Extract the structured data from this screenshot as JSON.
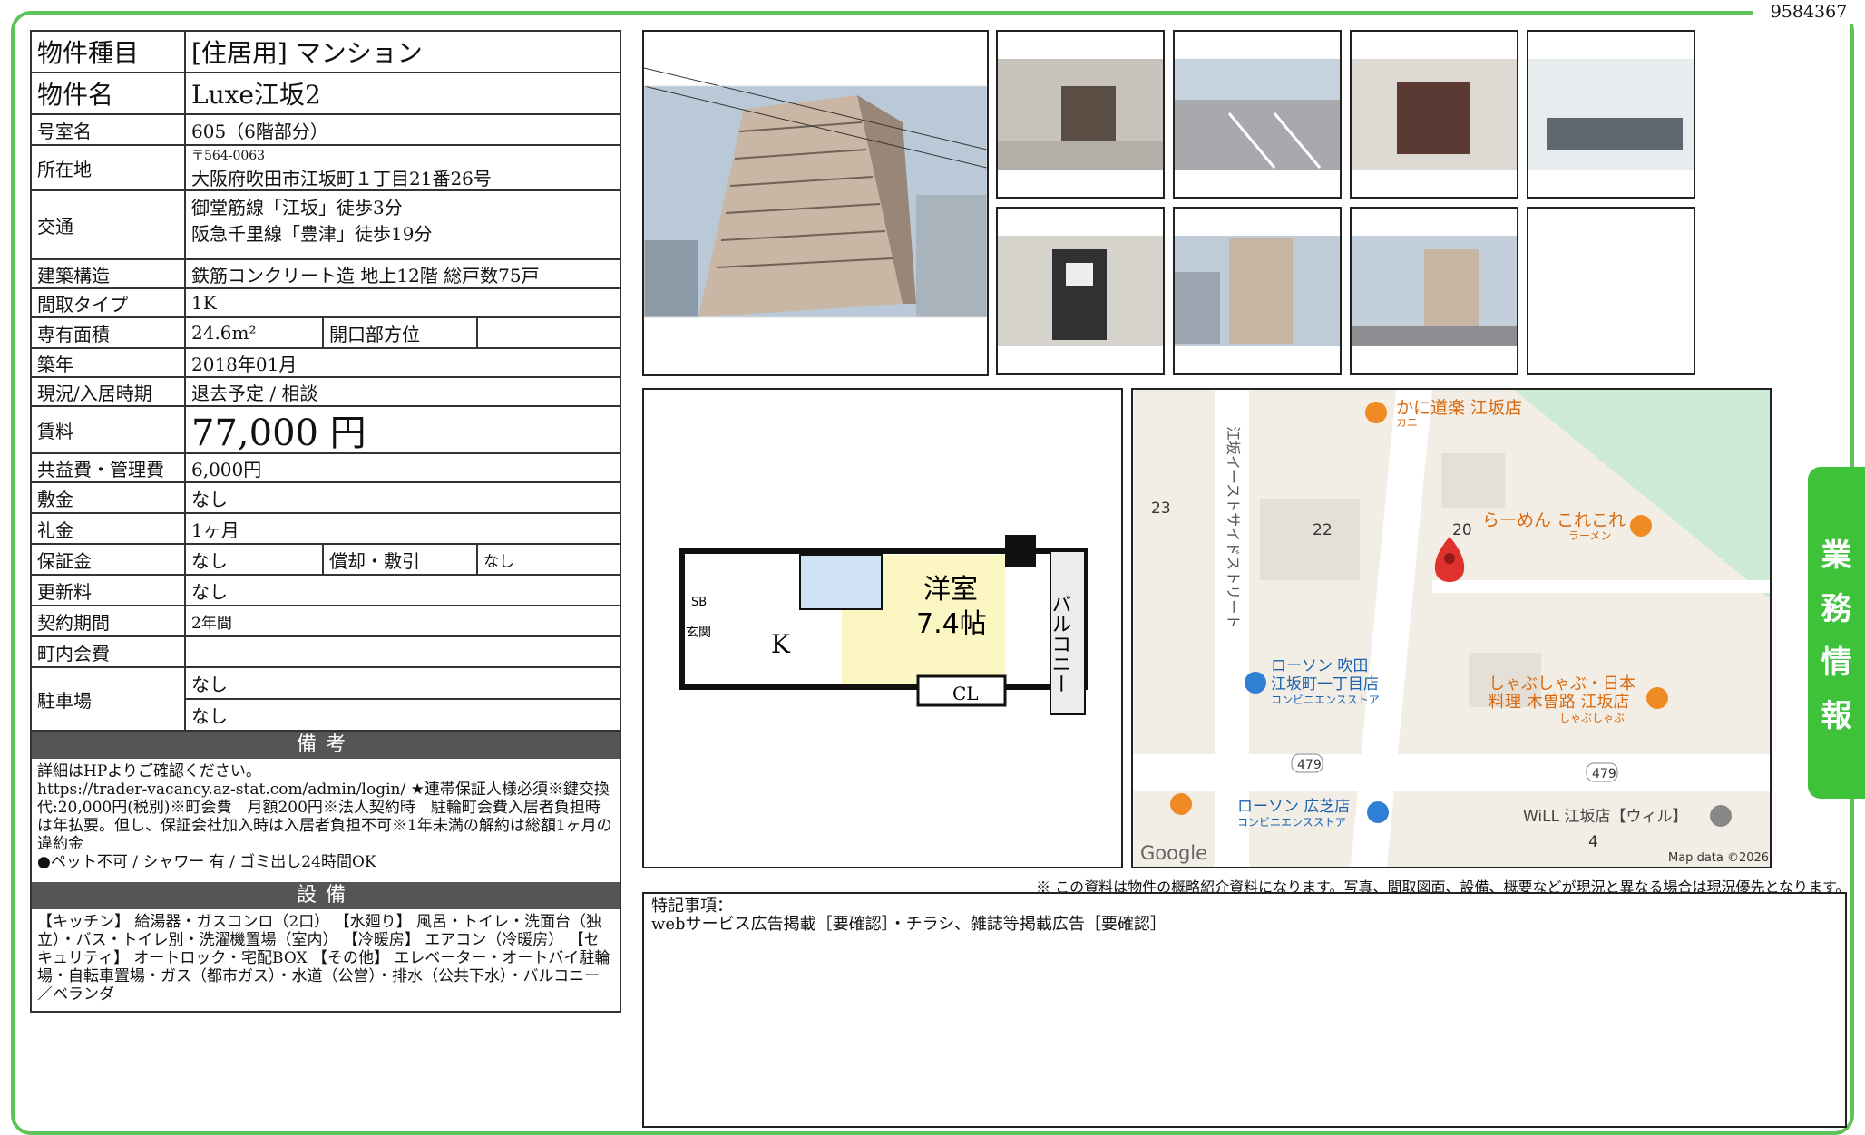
{
  "doc_id": "9584367",
  "side_tab": [
    "業",
    "務",
    "情",
    "報"
  ],
  "property": {
    "type_label": "物件種目",
    "type_value": "[住居用] マンション",
    "name_label": "物件名",
    "name_value": "Luxe江坂2",
    "room_label": "号室名",
    "room_value": "605（6階部分）",
    "address_label": "所在地",
    "postal": "〒564-0063",
    "address": "大阪府吹田市江坂町１丁目21番26号",
    "transport_label": "交通",
    "transport_1": "御堂筋線「江坂」徒歩3分",
    "transport_2": "阪急千里線「豊津」徒歩19分",
    "structure_label": "建築構造",
    "structure_value": "鉄筋コンクリート造 地上12階 総戸数75戸",
    "layout_label": "間取タイプ",
    "layout_value": "1K",
    "area_label": "専有面積",
    "area_value": "24.6m²",
    "direction_label": "開口部方位",
    "direction_value": "",
    "built_label": "築年",
    "built_value": "2018年01月",
    "status_label": "現況/入居時期",
    "status_value": "退去予定 / 相談",
    "rent_label": "賃料",
    "rent_value": "77,000 円",
    "fee_label": "共益費・管理費",
    "fee_value": "6,000円",
    "deposit_label": "敷金",
    "deposit_value": "なし",
    "key_money_label": "礼金",
    "key_money_value": "1ヶ月",
    "guarantee_label": "保証金",
    "guarantee_value": "なし",
    "amort_label": "償却・敷引",
    "amort_value": "なし",
    "renewal_label": "更新料",
    "renewal_value": "なし",
    "contract_label": "契約期間",
    "contract_value": "2年間",
    "town_fee_label": "町内会費",
    "town_fee_value": "",
    "parking_label": "駐車場",
    "parking_value_1": "なし",
    "parking_value_2": "なし"
  },
  "remarks_head": "備考",
  "remarks_text": "詳細はHPよりご確認ください。\nhttps://trader-vacancy.az-stat.com/admin/login/ ★連帯保証人様必須※鍵交換代:20,000円(税別)※町会費　月額200円※法人契約時　駐輪町会費入居者負担時は年払要。但し、保証会社加入時は入居者負担不可※1年未満の解約は総額1ヶ月の違約金\n●ペット不可 / シャワー 有 / ゴミ出し24時間OK",
  "equipment_head": "設備",
  "equipment_text": "【キッチン】 給湯器・ガスコンロ（2口） 【水廻り】 風呂・トイレ・洗面台（独立）・バス・トイレ別・洗濯機置場（室内） 【冷暖房】 エアコン（冷暖房） 【セキュリティ】 オートロック・宅配BOX 【その他】 エレベーター・オートバイ駐輪場・自転車置場・ガス（都市ガス）・水道（公営）・排水（公共下水）・バルコニー／ベランダ",
  "floorplan": {
    "room_name": "洋室",
    "room_size": "7.4帖",
    "kitchen": "K",
    "closet": "CL",
    "balcony": "バルコニー",
    "sb": "SB",
    "entrance": "玄関"
  },
  "map": {
    "street_vertical": "江坂イーストサイドストリート",
    "poi_1": "かに道楽 江坂店",
    "poi_1_sub": "カニ",
    "poi_2": "らーめん これこれ",
    "poi_2_sub": "ラーメン",
    "poi_3": "ローソン 吹田",
    "poi_3b": "江坂町一丁目店",
    "poi_3_sub": "コンビニエンスストア",
    "poi_4": "しゃぶしゃぶ・日本",
    "poi_4b": "料理 木曽路 江坂店",
    "poi_4_sub": "しゃぶしゃぶ",
    "poi_5": "ローソン 広芝店",
    "poi_5_sub": "コンビニエンスストア",
    "poi_6": "WiLL 江坂店【ウィル】",
    "block_23": "23",
    "block_22": "22",
    "block_20": "20",
    "block_4": "4",
    "route_1": "479",
    "route_2": "479",
    "google": "Google",
    "map_data": "Map data ©2026"
  },
  "disclaimer": "※ この資料は物件の概略紹介資料になります。写真、間取図面、設備、概要などが現況と異なる場合は現況優先となります。",
  "special_notes_label": "特記事項：",
  "special_notes_text": "webサービス広告掲載［要確認］・チラシ、雑誌等掲載広告［要確認］"
}
